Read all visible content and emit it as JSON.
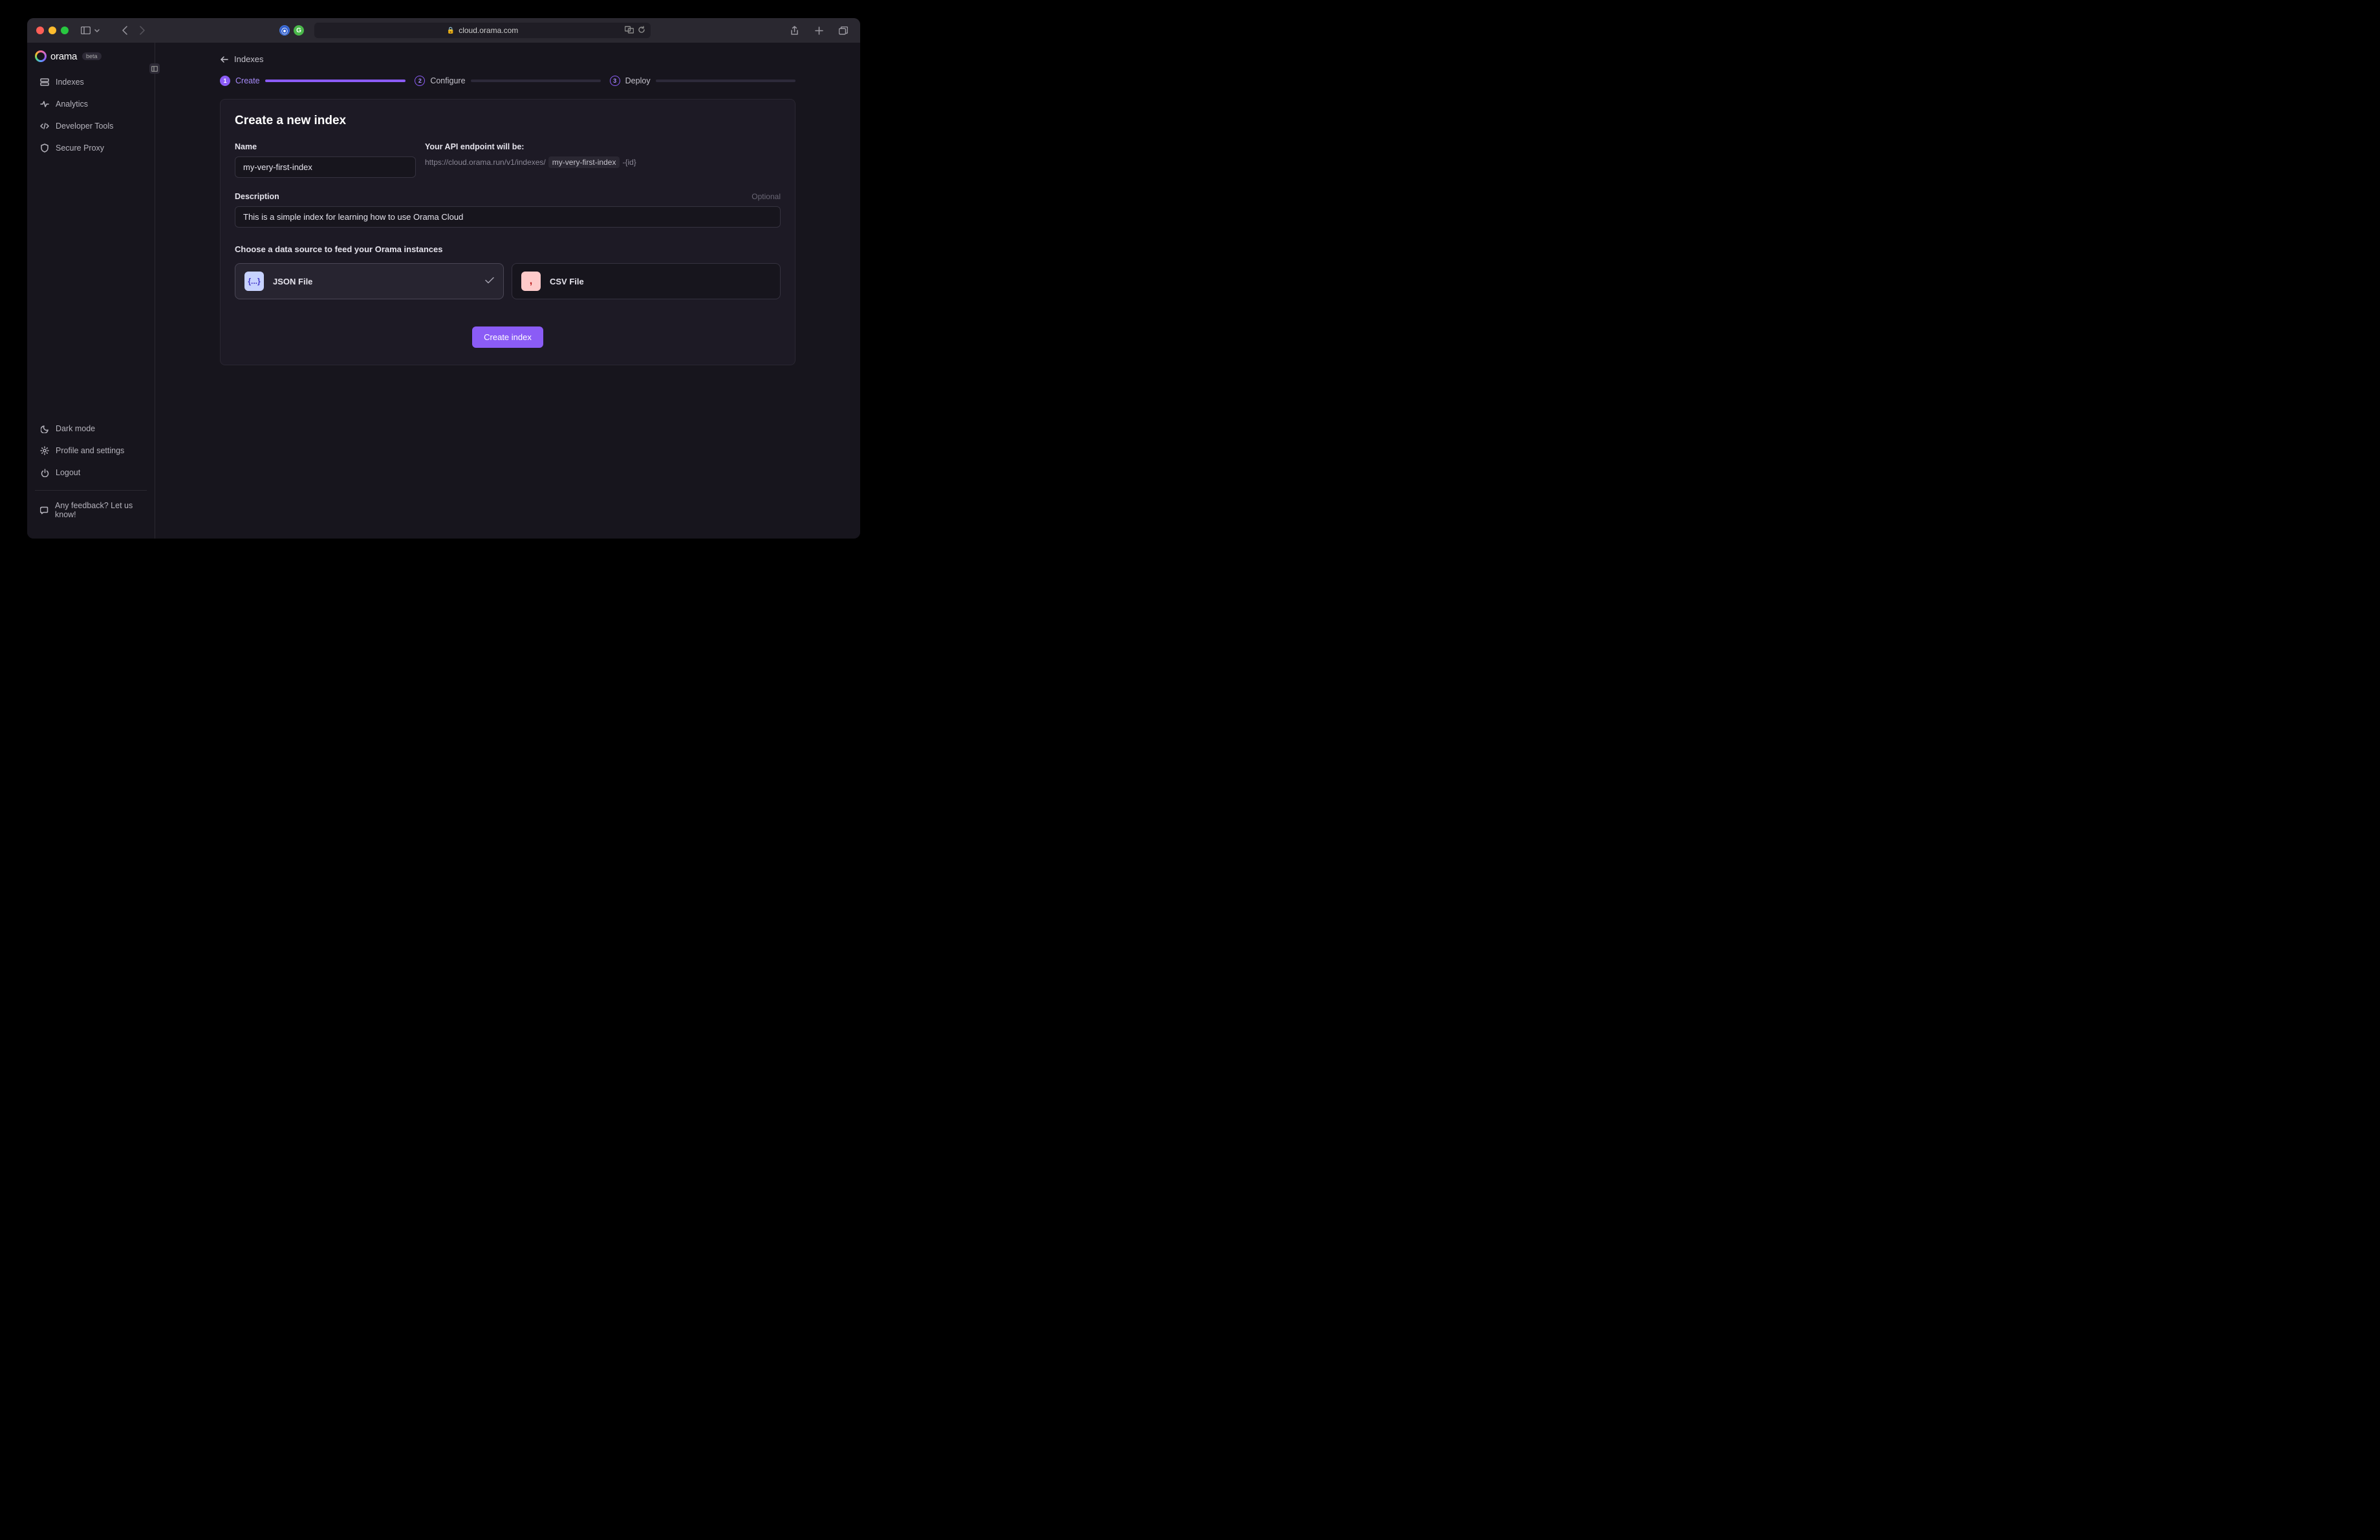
{
  "browser": {
    "url": "cloud.orama.com"
  },
  "brand": {
    "name": "orama",
    "badge": "beta"
  },
  "sidebar": {
    "items": [
      {
        "label": "Indexes"
      },
      {
        "label": "Analytics"
      },
      {
        "label": "Developer Tools"
      },
      {
        "label": "Secure Proxy"
      }
    ],
    "bottom": [
      {
        "label": "Dark mode"
      },
      {
        "label": "Profile and settings"
      },
      {
        "label": "Logout"
      }
    ],
    "feedback": "Any feedback? Let us know!"
  },
  "breadcrumb": {
    "label": "Indexes"
  },
  "stepper": {
    "steps": [
      {
        "num": "1",
        "label": "Create"
      },
      {
        "num": "2",
        "label": "Configure"
      },
      {
        "num": "3",
        "label": "Deploy"
      }
    ]
  },
  "form": {
    "title": "Create a new index",
    "nameLabel": "Name",
    "nameValue": "my-very-first-index",
    "apiLabel": "Your API endpoint will be:",
    "apiPrefix": "https://cloud.orama.run/v1/indexes/",
    "apiSlug": "my-very-first-index",
    "apiSuffix": "-{id}",
    "descLabel": "Description",
    "descOptional": "Optional",
    "descValue": "This is a simple index for learning how to use Orama Cloud",
    "sourceLabel": "Choose a data source to feed your Orama instances",
    "sources": [
      {
        "label": "JSON File",
        "iconText": "{...}"
      },
      {
        "label": "CSV File",
        "iconText": ","
      }
    ],
    "submit": "Create index"
  }
}
